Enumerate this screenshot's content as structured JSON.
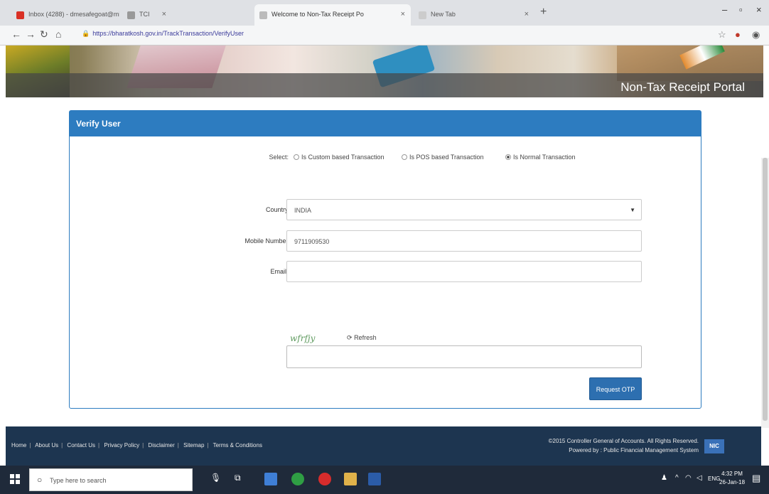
{
  "browser": {
    "tabs": [
      {
        "label": "Inbox (4288) - dmesafegoat@mi",
        "active": false
      },
      {
        "label": "TCI",
        "active": false
      },
      {
        "label": "Welcome to Non-Tax Receipt Po",
        "active": true
      },
      {
        "label": "New Tab",
        "active": false
      }
    ],
    "url": "https://bharatkosh.gov.in/TrackTransaction/VerifyUser"
  },
  "banner": {
    "title": "Non-Tax Receipt Portal"
  },
  "panel": {
    "header": "Verify User",
    "select_label": "Select:",
    "options": [
      {
        "label": "Is Custom based Transaction",
        "selected": false
      },
      {
        "label": "Is POS based Transaction",
        "selected": false
      },
      {
        "label": "Is Normal Transaction",
        "selected": true
      }
    ],
    "country_label": "Country:",
    "country_value": "INDIA",
    "mobile_label": "Mobile Number:",
    "mobile_value": "9711909530",
    "email_label": "Email :",
    "email_value": "",
    "captcha_text": "wfrfjy",
    "refresh_label": "Refresh",
    "captcha_value": "",
    "request_otp_label": "Request OTP"
  },
  "footer": {
    "links": [
      "Home",
      "About Us",
      "Contact Us",
      "Privacy Policy",
      "Disclaimer",
      "Sitemap",
      "Terms & Conditions"
    ],
    "copyright": "©2015 Controller General of Accounts. All Rights Reserved.",
    "powered": "Powered by : Public Financial Management System",
    "badge": "NIC"
  },
  "taskbar": {
    "search_placeholder": "Type here to search",
    "time": "4:32 PM",
    "date": "26-Jan-18"
  },
  "colors": {
    "accent": "#2d7cc0",
    "footer_bg": "#1d3550",
    "button": "#2d6fb0"
  }
}
